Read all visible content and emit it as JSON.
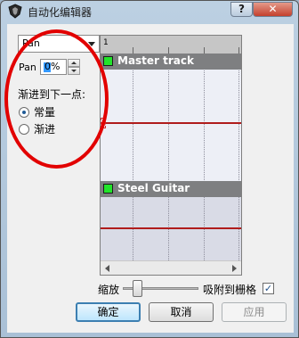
{
  "window": {
    "title": "自动化编辑器",
    "help_label": "?",
    "close_label": "✕"
  },
  "params": {
    "selected": "Pan",
    "pan_label": "Pan",
    "pan_value": "0%"
  },
  "mode": {
    "label": "渐进到下一点:",
    "options": [
      "常量",
      "渐进"
    ],
    "selected": "常量"
  },
  "timeline": {
    "ruler_start": "1",
    "tracks": [
      {
        "name": "Master track",
        "color": "#22e42a"
      },
      {
        "name": "Steel Guitar",
        "color": "#22e42a"
      }
    ]
  },
  "zoom": {
    "label": "缩放",
    "snap_label": "吸附到栅格",
    "snap_checked": true
  },
  "buttons": {
    "ok": "确定",
    "cancel": "取消",
    "apply": "应用"
  },
  "annotation_color": "#e20000"
}
